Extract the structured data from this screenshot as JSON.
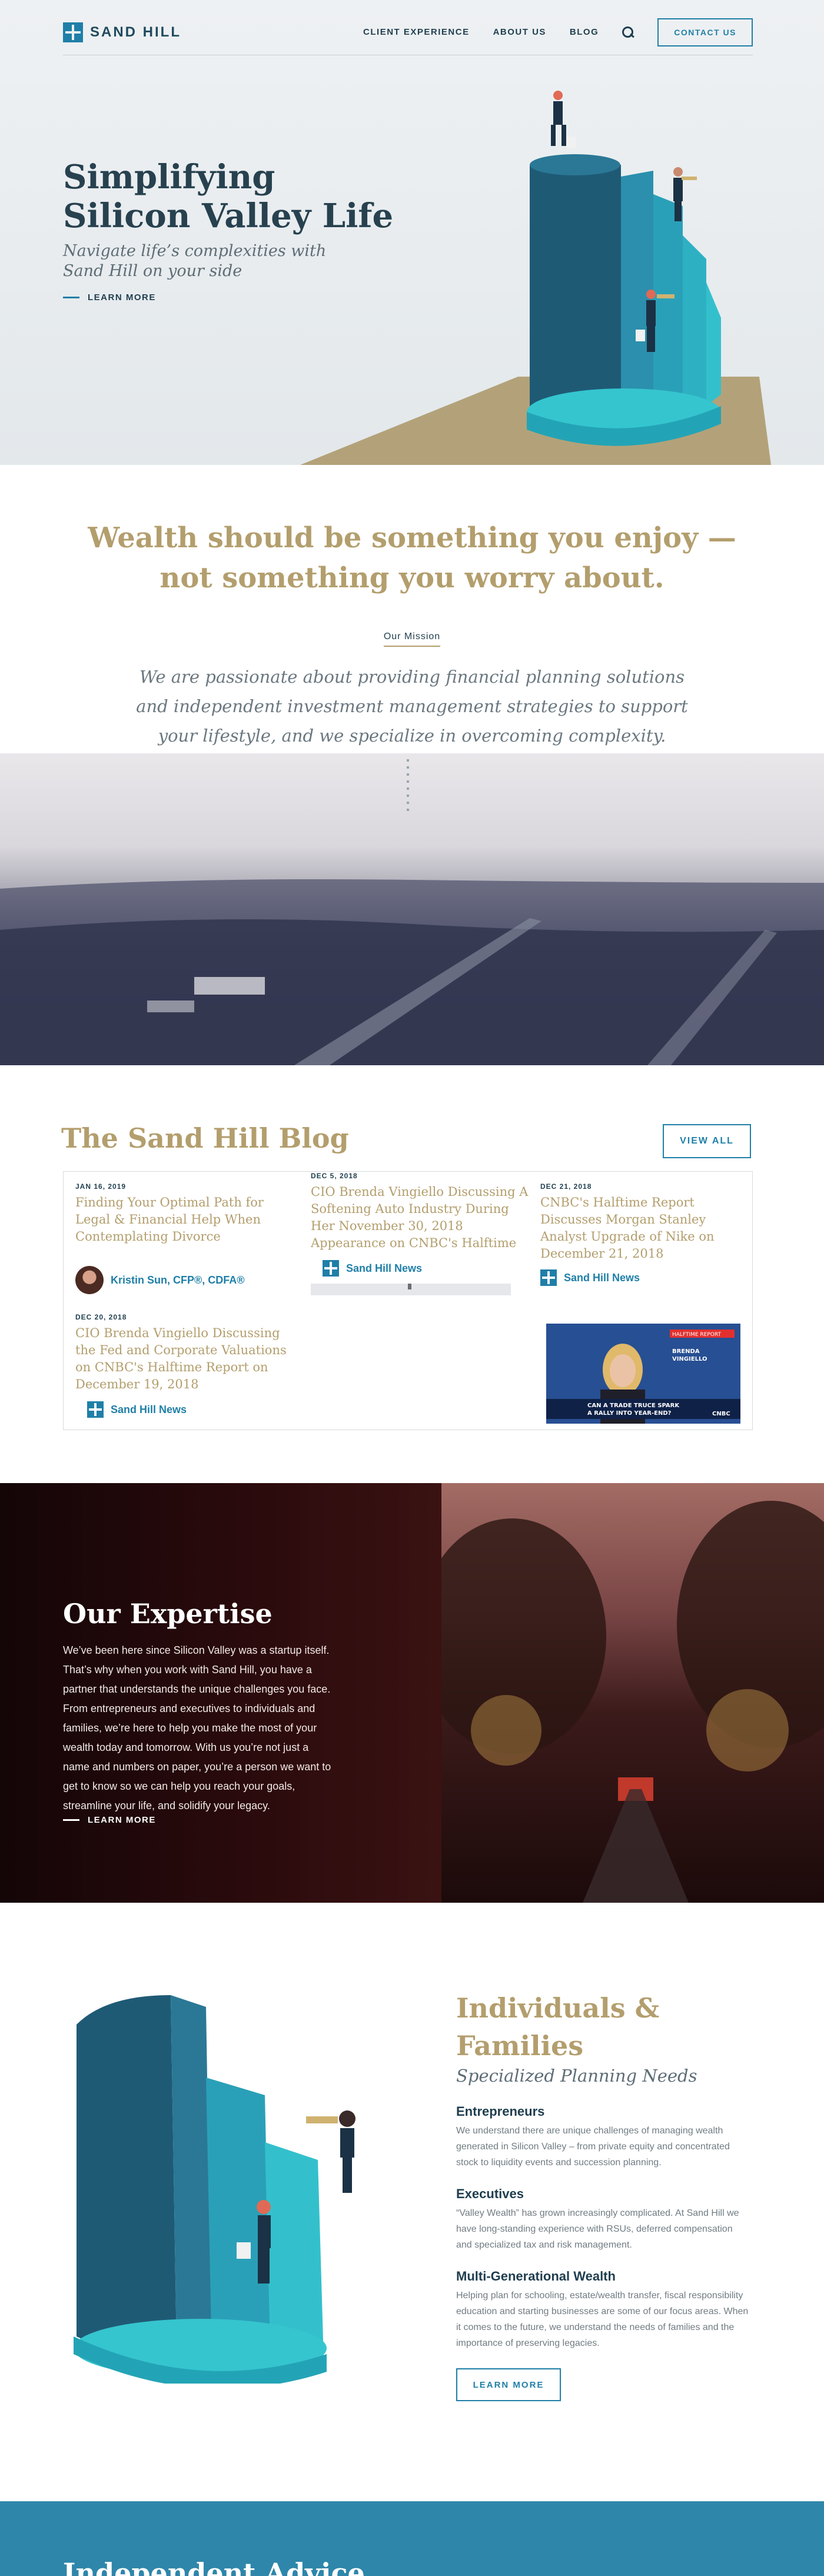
{
  "brand": {
    "name": "SAND HILL",
    "accent": "#1f7fa8",
    "gold": "#b39e6d",
    "navy": "#1f3e4f"
  },
  "nav": {
    "items": [
      "CLIENT EXPERIENCE",
      "ABOUT US",
      "BLOG"
    ],
    "search_icon": "search-icon",
    "contact_label": "CONTACT US"
  },
  "hero": {
    "title_line1": "Simplifying",
    "title_line2": "Silicon Valley Life",
    "subtitle": "Navigate life’s complexities with Sand Hill on your side",
    "learn_more": "LEARN MORE"
  },
  "mission": {
    "quote_line1": "Wealth should be something you enjoy —",
    "quote_line2": "not something you worry about.",
    "label": "Our Mission",
    "text": "We are passionate about providing financial planning solutions and independent investment management strategies to support your lifestyle, and we specialize in overcoming complexity."
  },
  "blog": {
    "title": "The Sand Hill Blog",
    "view_all": "VIEW ALL",
    "cards": [
      {
        "date": "JAN 16, 2019",
        "title": "Finding Your Optimal Path for Legal & Financial Help When Contemplating Divorce",
        "author": "Kristin Sun, CFP®, CDFA®"
      },
      {
        "date": "DEC 21, 2018",
        "title": "CNBC's Halftime Report Discusses Morgan Stanley Analyst Upgrade of Nike on December 21, 2018",
        "author": "Sand Hill News"
      },
      {
        "date": "DEC 20, 2018",
        "title": "CIO Brenda Vingiello Discussing the Fed and Corporate Valuations on CNBC's Halftime Report on December 19, 2018",
        "author": "Sand Hill News"
      },
      {
        "date": "DEC 5, 2018",
        "title": "CIO Brenda Vingiello Discussing A Softening Auto Industry During Her November 30, 2018 Appearance on CNBC's Halftime Report",
        "author": "Sand Hill News"
      }
    ],
    "tv": {
      "tag": "HALFTIME REPORT",
      "name_line1": "BRENDA",
      "name_line2": "VINGIELLO",
      "ticker1": "CAN A TRADE TRUCE SPARK",
      "ticker2": "A RALLY INTO YEAR-END?",
      "network": "CNBC"
    }
  },
  "expertise": {
    "title": "Our Expertise",
    "text": "We’ve been here since Silicon Valley was a startup itself. That’s why when you work with Sand Hill, you have a partner that understands the unique challenges you face. From entrepreneurs and executives to individuals and families, we’re here to help you make the most of your wealth today and tomorrow. With us you’re not just a name and numbers on paper, you’re a person we want to get to know so we can help you reach your goals, streamline your life, and solidify your legacy.",
    "learn_more": "LEARN MORE"
  },
  "families": {
    "title_line1": "Individuals &",
    "title_line2": "Families",
    "subtitle": "Specialized Planning Needs",
    "blocks": [
      {
        "head": "Entrepreneurs",
        "text": "We understand there are unique challenges of managing wealth generated in Silicon Valley – from private equity and concentrated stock to liquidity events and succession planning."
      },
      {
        "head": "Executives",
        "text": "“Valley Wealth” has grown increasingly complicated. At Sand Hill we have long-standing experience with RSUs, deferred compensation and specialized tax and risk management."
      },
      {
        "head": "Multi-Generational Wealth",
        "text": "Helping plan for schooling, estate/wealth transfer, fiscal responsibility education and starting businesses are some of our focus areas. When it comes to the future, we understand the needs of families and the importance of preserving legacies."
      }
    ],
    "learn_more": "LEARN MORE"
  },
  "bottom": {
    "title": "Independent Advice"
  }
}
